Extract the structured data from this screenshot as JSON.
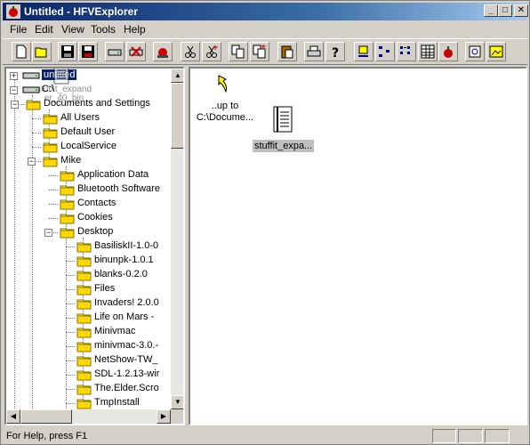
{
  "window": {
    "title": "Untitled - HFVExplorer",
    "minimize": "_",
    "maximize": "□",
    "close": "✕"
  },
  "menu": [
    "File",
    "Edit",
    "View",
    "Tools",
    "Help"
  ],
  "toolbar_icons": [
    "new-icon",
    "open-icon",
    "save-mac-icon",
    "save-icon",
    "mount-icon",
    "unmount-icon",
    "apple-eject-icon",
    "cut-icon",
    "cut-plus-icon",
    "copy-icon",
    "copy-plus-icon",
    "paste-icon",
    "print-icon",
    "help-icon",
    "large-icons-icon",
    "small-icons-icon",
    "list-icon",
    "details-icon",
    "apple-icon",
    "properties-icon",
    "image-icon"
  ],
  "tree": {
    "drag_ghost": {
      "line1": "stuffit_expand",
      "line2": "er_40_bin"
    },
    "root_item": "untitled",
    "drive": "C:\\",
    "items": [
      {
        "label": "Documents and Settings"
      },
      {
        "label": "All Users"
      },
      {
        "label": "Default User"
      },
      {
        "label": "LocalService"
      },
      {
        "label": "Mike"
      },
      {
        "label": "Application Data"
      },
      {
        "label": "Bluetooth Software"
      },
      {
        "label": "Contacts"
      },
      {
        "label": "Cookies"
      },
      {
        "label": "Desktop"
      },
      {
        "label": "BasiliskII-1.0-0"
      },
      {
        "label": "binunpk-1.0.1"
      },
      {
        "label": "blanks-0.2.0"
      },
      {
        "label": "Files"
      },
      {
        "label": "Invaders! 2.0.0"
      },
      {
        "label": "Life on Mars -"
      },
      {
        "label": "Minivmac"
      },
      {
        "label": "minivmac-3.0.-"
      },
      {
        "label": "NetShow-TW_"
      },
      {
        "label": "SDL-1.2.13-wir"
      },
      {
        "label": "The.Elder.Scro"
      },
      {
        "label": "TmpInstall"
      }
    ]
  },
  "files": {
    "up": {
      "line1": "..up to",
      "line2": "C:\\Docume..."
    },
    "file": {
      "label": "stuffit_expa..."
    }
  },
  "status": {
    "text": "For Help, press F1"
  }
}
